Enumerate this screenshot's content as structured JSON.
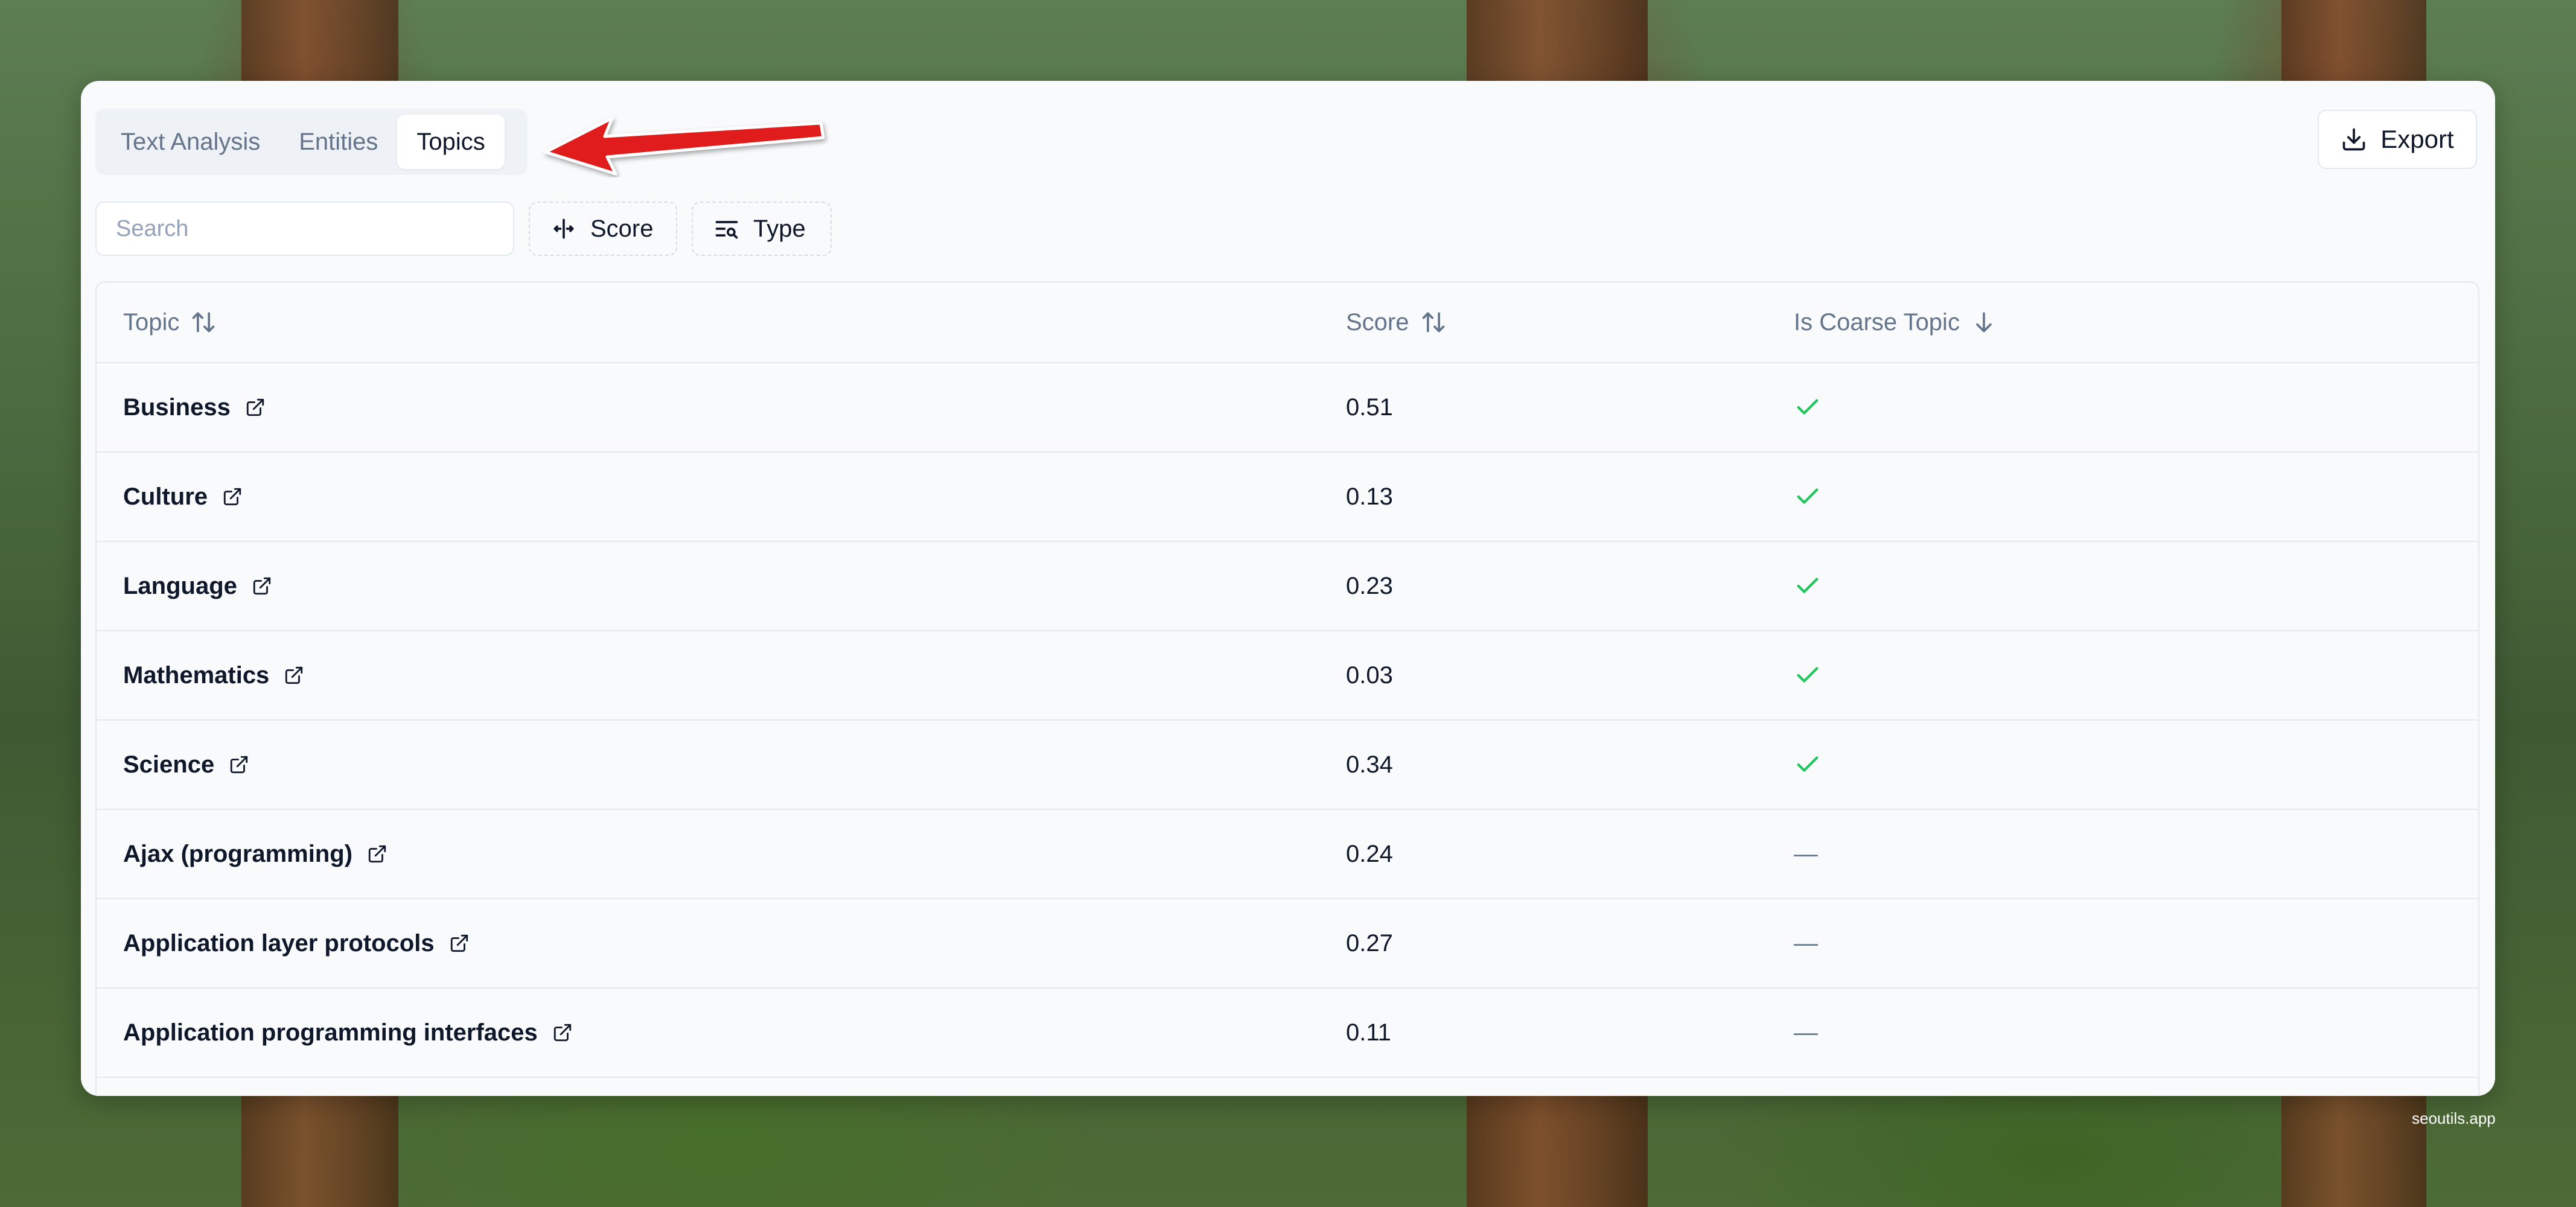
{
  "tabs": [
    {
      "label": "Text Analysis",
      "active": false
    },
    {
      "label": "Entities",
      "active": false
    },
    {
      "label": "Topics",
      "active": true
    }
  ],
  "toolbar": {
    "export_label": "Export",
    "search_placeholder": "Search",
    "score_filter_label": "Score",
    "type_filter_label": "Type"
  },
  "table": {
    "headers": {
      "topic": "Topic",
      "score": "Score",
      "coarse": "Is Coarse Topic"
    },
    "rows": [
      {
        "topic": "Business",
        "score": "0.51",
        "coarse": "check"
      },
      {
        "topic": "Culture",
        "score": "0.13",
        "coarse": "check"
      },
      {
        "topic": "Language",
        "score": "0.23",
        "coarse": "check"
      },
      {
        "topic": "Mathematics",
        "score": "0.03",
        "coarse": "check"
      },
      {
        "topic": "Science",
        "score": "0.34",
        "coarse": "check"
      },
      {
        "topic": "Ajax (programming)",
        "score": "0.24",
        "coarse": "—"
      },
      {
        "topic": "Application layer protocols",
        "score": "0.27",
        "coarse": "—"
      },
      {
        "topic": "Application programming interfaces",
        "score": "0.11",
        "coarse": "—"
      }
    ]
  },
  "watermark": "seoutils.app",
  "colors": {
    "check": "#22c55e",
    "arrow": "#e01b1b",
    "muted_text": "#64748b"
  }
}
